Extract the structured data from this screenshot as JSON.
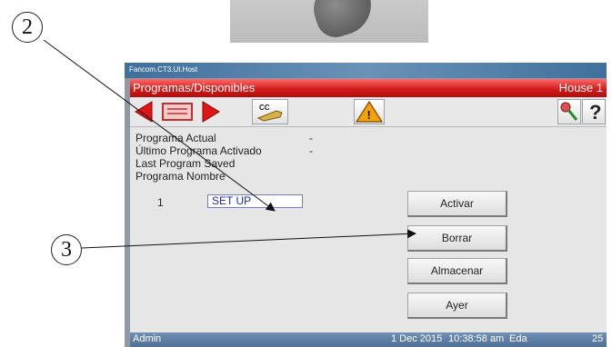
{
  "callouts": {
    "first": "2",
    "second": "3"
  },
  "window": {
    "title": "Fancom.CT3.UI.Host"
  },
  "header": {
    "title": "Programas/Disponibles",
    "house": "House 1"
  },
  "toolbar": {
    "buttons": [
      "back-arrow",
      "program-list",
      "forward-arrow",
      "cc-key",
      "warning",
      "key",
      "help"
    ],
    "cc_label": "CC",
    "warning_glyph": "!",
    "help_label": "?"
  },
  "info": {
    "programa_actual": "Programa Actual",
    "programa_actual_value": "-",
    "ultimo_programa": "Último Programa Activado",
    "ultimo_programa_value": "-",
    "last_saved": "Last Program Saved",
    "programa_nombre": "Programa Nombre"
  },
  "program_list": [
    {
      "number": "1",
      "name": "SET UP"
    }
  ],
  "actions": {
    "activar": "Activar",
    "borrar": "Borrar",
    "almacenar": "Almacenar",
    "ayer": "Ayer"
  },
  "status": {
    "user": "Admin",
    "date": "1 Dec 2015",
    "time": "10:38:58 am",
    "unit": "Eda",
    "num": "25"
  },
  "colors": {
    "header_red": "#d41c1c",
    "statusbar_blue": "#4f6f97",
    "field_text": "#1a2b9a"
  },
  "icons": [
    "hand-photo",
    "back-arrow-icon",
    "list-icon",
    "forward-arrow-icon",
    "cc-key-icon",
    "warning-icon",
    "key-icon",
    "help-icon"
  ]
}
